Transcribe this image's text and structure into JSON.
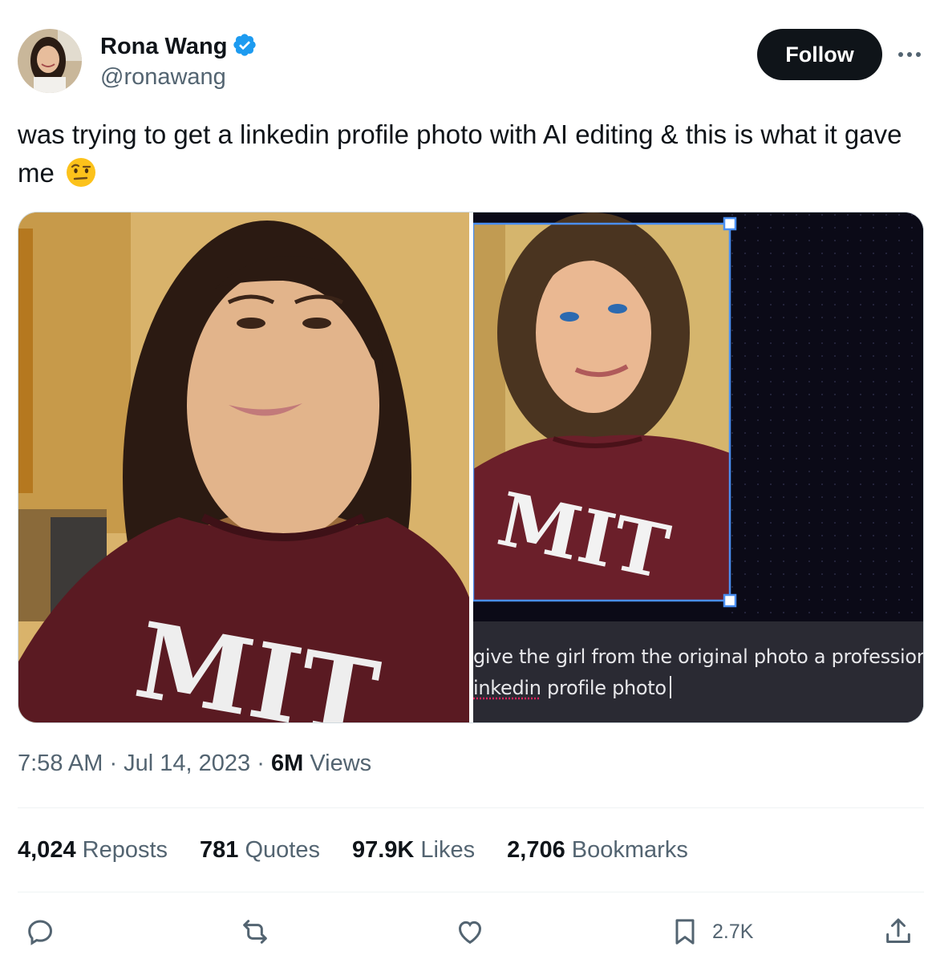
{
  "author": {
    "name": "Rona Wang",
    "handle": "@ronawang",
    "verified": true
  },
  "follow_label": "Follow",
  "tweet": {
    "text": "was trying to get a linkedin profile photo with AI editing & this is what it gave me",
    "emoji": "face-with-raised-eyebrow"
  },
  "media": {
    "left_shirt_text": "MIT",
    "right_shirt_text": "MIT",
    "prompt_line1": "give the girl from the original photo a professiona",
    "prompt_line2_word": "inkedin",
    "prompt_line2_rest": " profile photo"
  },
  "meta": {
    "time": "7:58 AM · Jul 14, 2023 · ",
    "views_count": "6M",
    "views_label": " Views"
  },
  "stats": {
    "reposts_count": "4,024",
    "reposts_label": " Reposts",
    "quotes_count": "781",
    "quotes_label": " Quotes",
    "likes_count": "97.9K",
    "likes_label": " Likes",
    "bookmarks_count": "2,706",
    "bookmarks_label": " Bookmarks"
  },
  "actions": {
    "bookmark_count": "2.7K"
  },
  "colors": {
    "text": "#0f1419",
    "secondary": "#536471",
    "verified": "#1d9bf0",
    "shirt": "#6b1f2a",
    "selection": "#4a8ef0"
  }
}
